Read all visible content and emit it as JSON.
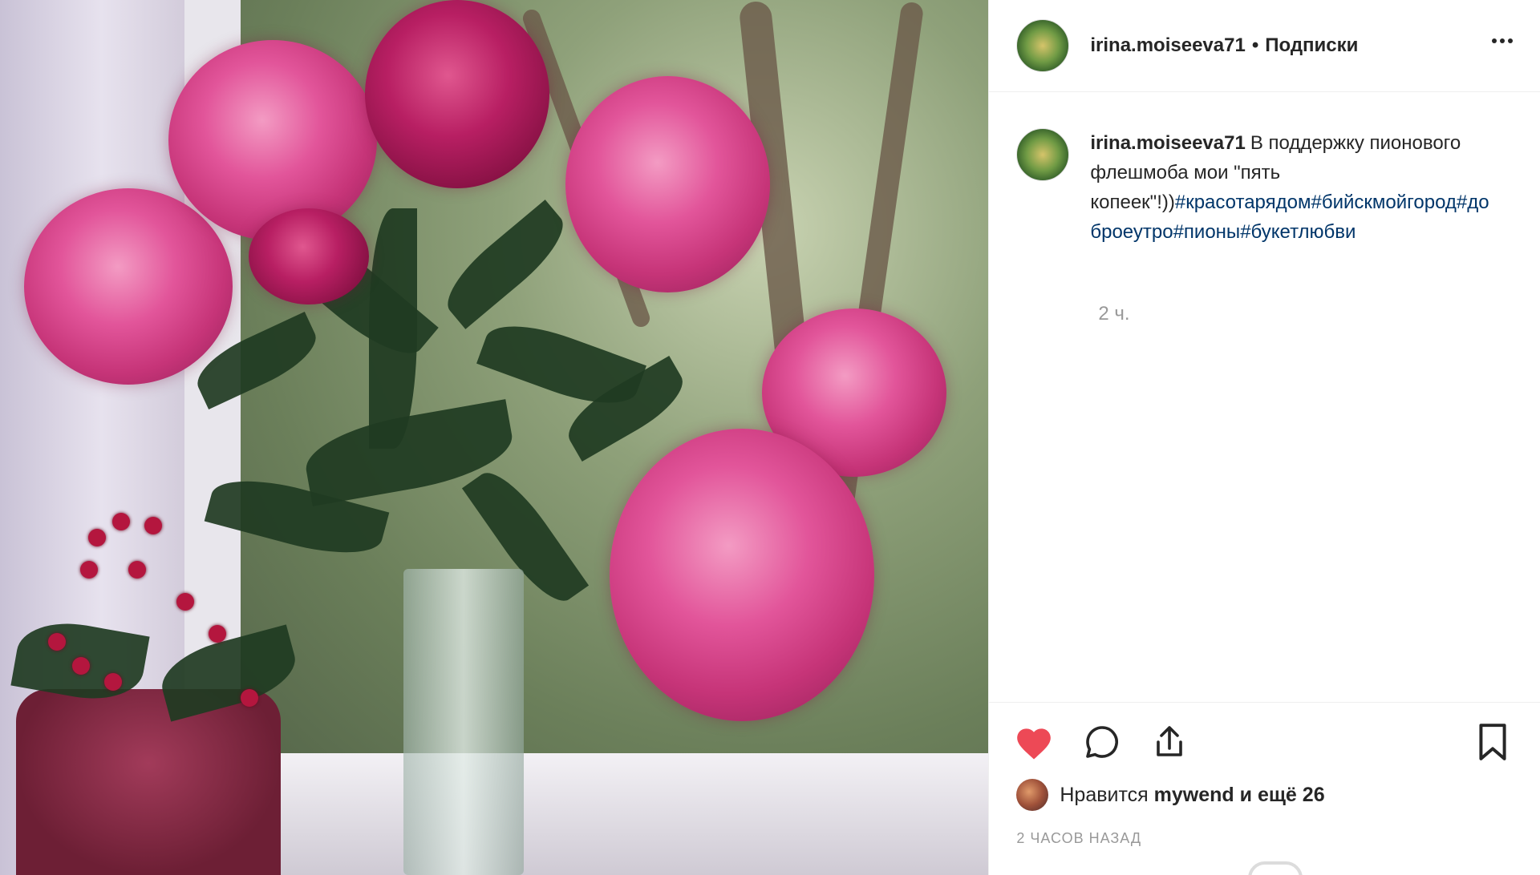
{
  "header": {
    "username": "irina.moiseeva71",
    "separator": "•",
    "follow_label": "Подписки",
    "more_icon": "more-horizontal-icon"
  },
  "caption": {
    "username": "irina.moiseeva71",
    "text": "В поддержку пионового флешмоба мои \"пять копеек\"!))",
    "hashtags": [
      "#красотарядом",
      "#бийскмойгород",
      "#доброеутро",
      "#пионы",
      "#букетлюбви"
    ],
    "time": "2 ч."
  },
  "actions": {
    "like_icon": "heart-filled-icon",
    "comment_icon": "comment-icon",
    "share_icon": "share-icon",
    "save_icon": "bookmark-icon",
    "like_color": "#ed4956"
  },
  "likes": {
    "prefix": "Нравится",
    "user": "mywend",
    "suffix": "и ещё 26"
  },
  "date": "2 ЧАСОВ НАЗАД",
  "colors": {
    "text": "#262626",
    "muted": "#999999",
    "hashtag": "#003569",
    "border": "#efefef"
  }
}
